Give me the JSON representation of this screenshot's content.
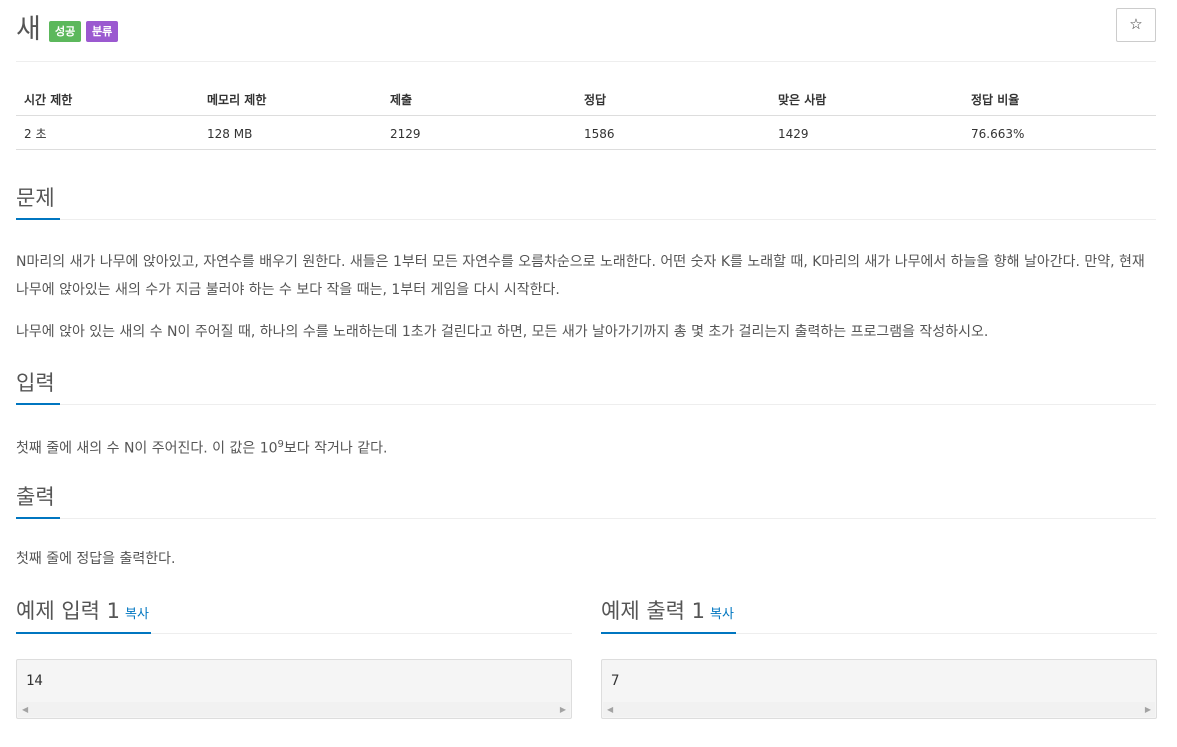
{
  "problem": {
    "title": "새",
    "labels": {
      "success": "성공",
      "category": "분류"
    },
    "star_glyph": "☆"
  },
  "stats": {
    "headers": [
      "시간 제한",
      "메모리 제한",
      "제출",
      "정답",
      "맞은 사람",
      "정답 비율"
    ],
    "values": [
      "2 초",
      "128 MB",
      "2129",
      "1586",
      "1429",
      "76.663%"
    ]
  },
  "sections": {
    "description": {
      "title": "문제",
      "paragraphs": [
        "N마리의 새가 나무에 앉아있고, 자연수를 배우기 원한다. 새들은 1부터 모든 자연수를 오름차순으로 노래한다. 어떤 숫자 K를 노래할 때, K마리의 새가 나무에서 하늘을 향해 날아간다. 만약, 현재 나무에 앉아있는 새의 수가 지금 불러야 하는 수 보다 작을 때는, 1부터 게임을 다시 시작한다.",
        "나무에 앉아 있는 새의 수 N이 주어질 때, 하나의 수를 노래하는데 1초가 걸린다고 하면, 모든 새가 날아가기까지 총 몇 초가 걸리는지 출력하는 프로그램을 작성하시오."
      ]
    },
    "input": {
      "title": "입력",
      "text_before": "첫째 줄에 새의 수 N이 주어진다. 이 값은 10",
      "superscript": "9",
      "text_after": "보다 작거나 같다."
    },
    "output": {
      "title": "출력",
      "text": "첫째 줄에 정답을 출력한다."
    }
  },
  "samples": {
    "input": {
      "title": "예제 입력 1",
      "copy_label": "복사",
      "content": "14"
    },
    "output": {
      "title": "예제 출력 1",
      "copy_label": "복사",
      "content": "7"
    }
  },
  "colors": {
    "accent": "#0076c0",
    "label_success": "#5cb85c",
    "label_category": "#9b59d0"
  }
}
